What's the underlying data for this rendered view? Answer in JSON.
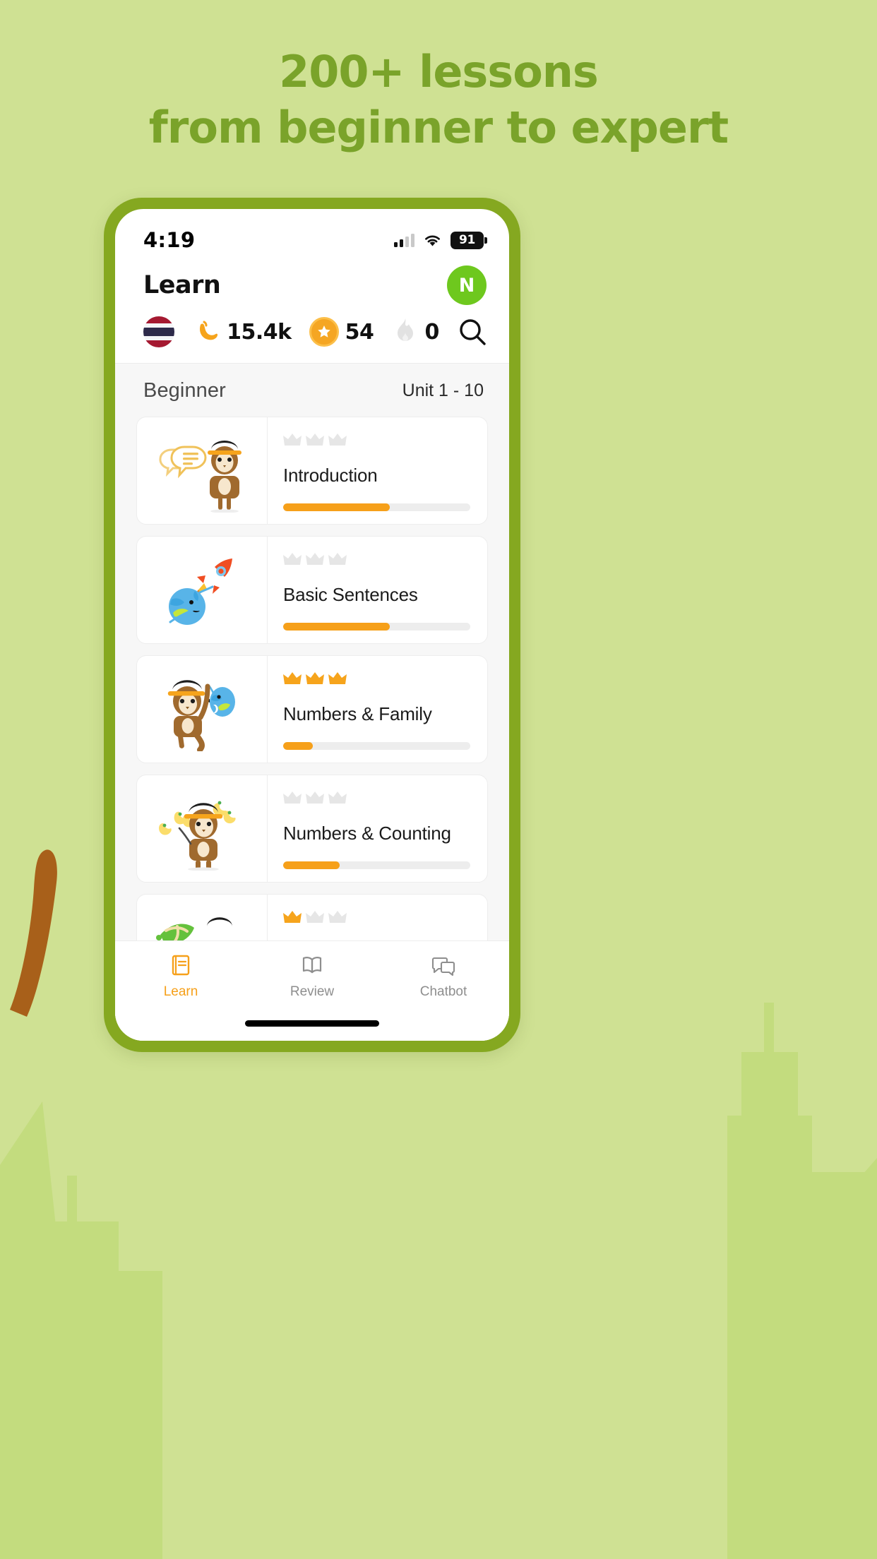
{
  "promo": {
    "line1": "200+ lessons",
    "line2": "from beginner to expert",
    "text_color": "#7aa32a",
    "background_color": "#cfe193"
  },
  "status_bar": {
    "time": "4:19",
    "battery_level": "91",
    "signal_icon": "cellular-signal-icon",
    "wifi_icon": "wifi-icon",
    "battery_icon": "battery-icon"
  },
  "app_header": {
    "title": "Learn",
    "avatar_initial": "N",
    "avatar_color": "#6ec81e"
  },
  "stats": {
    "flag_icon": "thailand-flag-icon",
    "items": [
      {
        "icon": "banana-icon",
        "value": "15.4k"
      },
      {
        "icon": "coin-icon",
        "value": "54"
      },
      {
        "icon": "flame-icon",
        "value": "0"
      }
    ],
    "search_icon": "search-icon"
  },
  "section": {
    "level": "Beginner",
    "unit_range": "Unit 1 - 10"
  },
  "lessons": [
    {
      "name": "Introduction",
      "illustration": "monkey-with-speech-bubbles-icon",
      "crowns_earned": 0,
      "crowns_total": 3,
      "progress_percent": 57
    },
    {
      "name": "Basic Sentences",
      "illustration": "rocket-and-earth-icon",
      "crowns_earned": 0,
      "crowns_total": 3,
      "progress_percent": 57
    },
    {
      "name": "Numbers & Family",
      "illustration": "monkey-with-balloon-icon",
      "crowns_earned": 3,
      "crowns_total": 3,
      "progress_percent": 16
    },
    {
      "name": "Numbers & Counting",
      "illustration": "monkey-with-bananas-icon",
      "crowns_earned": 0,
      "crowns_total": 3,
      "progress_percent": 30
    },
    {
      "name": "",
      "illustration": "monkey-in-leaves-icon",
      "crowns_earned": 1,
      "crowns_total": 3,
      "progress_percent": 0
    }
  ],
  "tabbar": {
    "tabs": [
      {
        "label": "Learn",
        "icon": "book-closed-icon",
        "active": true
      },
      {
        "label": "Review",
        "icon": "book-open-icon",
        "active": false
      },
      {
        "label": "Chatbot",
        "icon": "chat-bubbles-icon",
        "active": false
      }
    ],
    "active_color": "#f6a01a",
    "inactive_color": "#8e8e8e"
  }
}
